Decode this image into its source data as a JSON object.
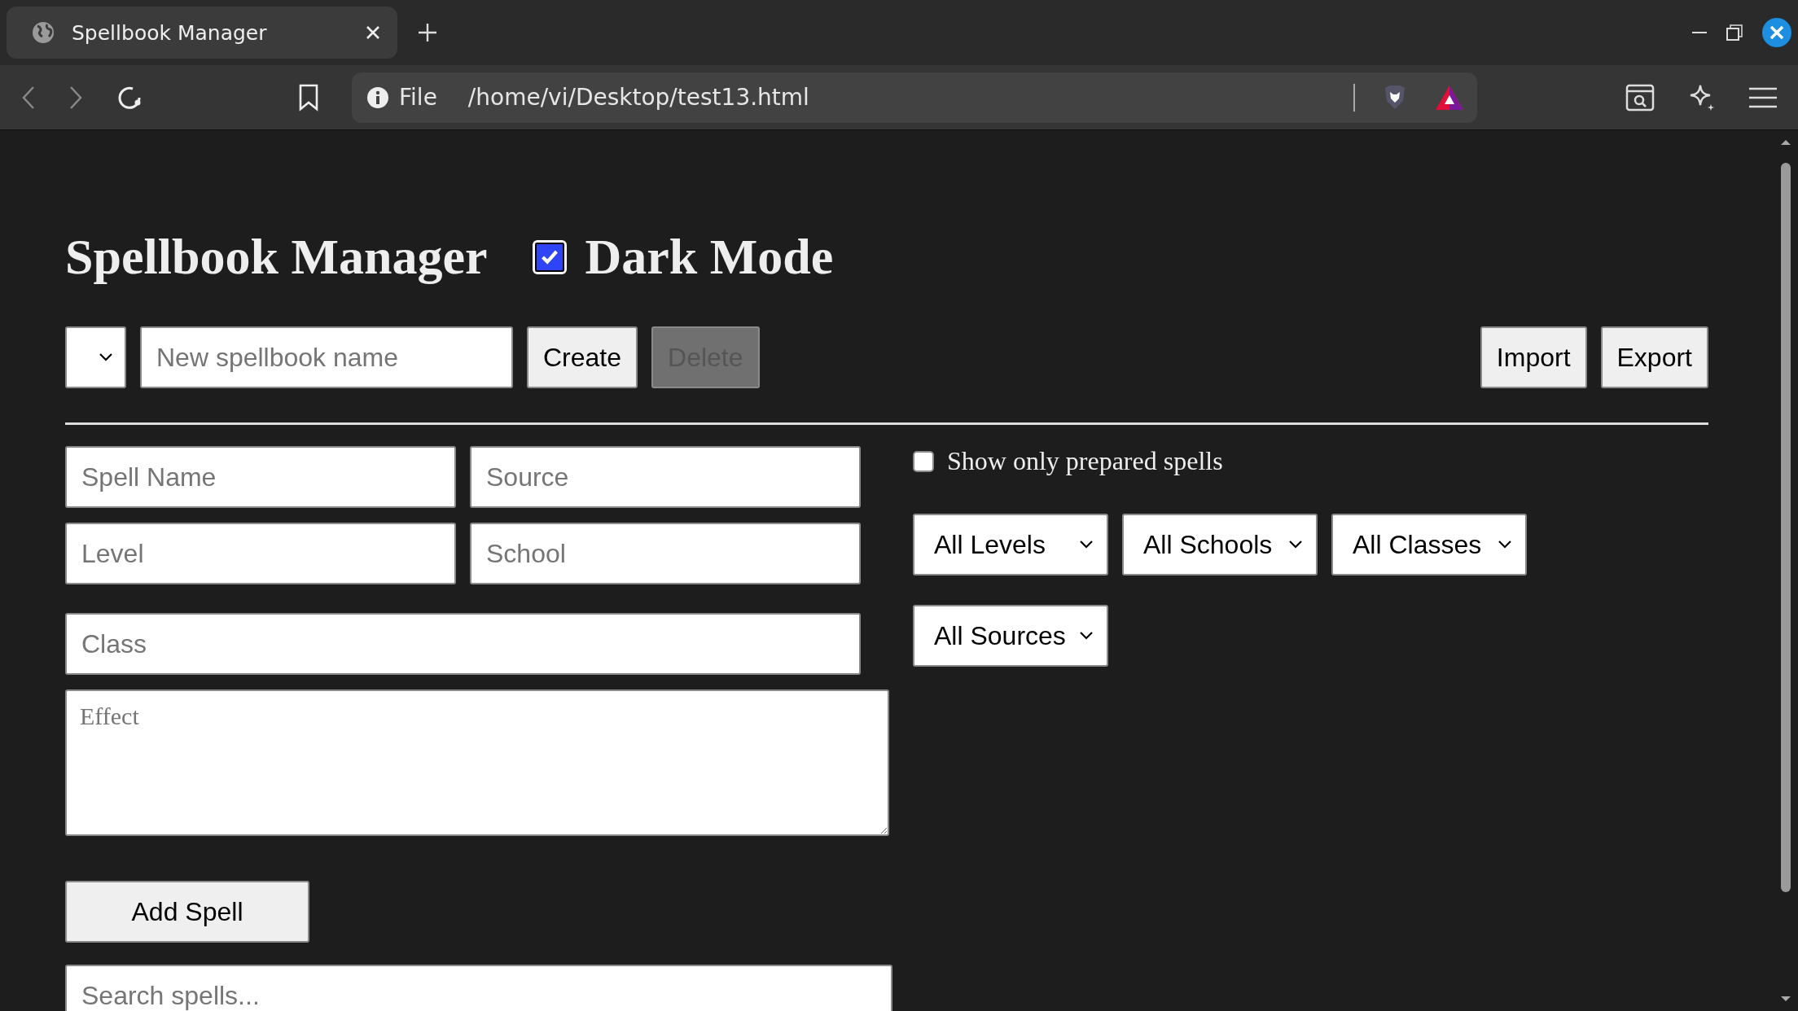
{
  "browser": {
    "tab": {
      "title": "Spellbook Manager"
    },
    "address": {
      "scheme": "File",
      "url": "/home/vi/Desktop/test13.html"
    }
  },
  "page": {
    "title": "Spellbook Manager",
    "dark_mode": {
      "label": "Dark Mode",
      "checked": true
    },
    "spellbook_bar": {
      "new_name_placeholder": "New spellbook name",
      "buttons": [
        {
          "label": "Create",
          "disabled": false
        },
        {
          "label": "Delete",
          "disabled": true
        }
      ],
      "io_buttons": [
        "Import",
        "Export"
      ]
    },
    "spell_form": {
      "fields": [
        {
          "placeholder": "Spell Name"
        },
        {
          "placeholder": "Source"
        },
        {
          "placeholder": "Level"
        },
        {
          "placeholder": "School"
        }
      ],
      "class_placeholder": "Class",
      "effect_placeholder": "Effect",
      "submit": "Add Spell"
    },
    "search": {
      "placeholder": "Search spells..."
    },
    "filters": {
      "prepared_only": {
        "label": "Show only prepared spells",
        "checked": false
      },
      "selects": [
        "All Levels",
        "All Schools",
        "All Classes",
        "All Sources"
      ]
    }
  }
}
